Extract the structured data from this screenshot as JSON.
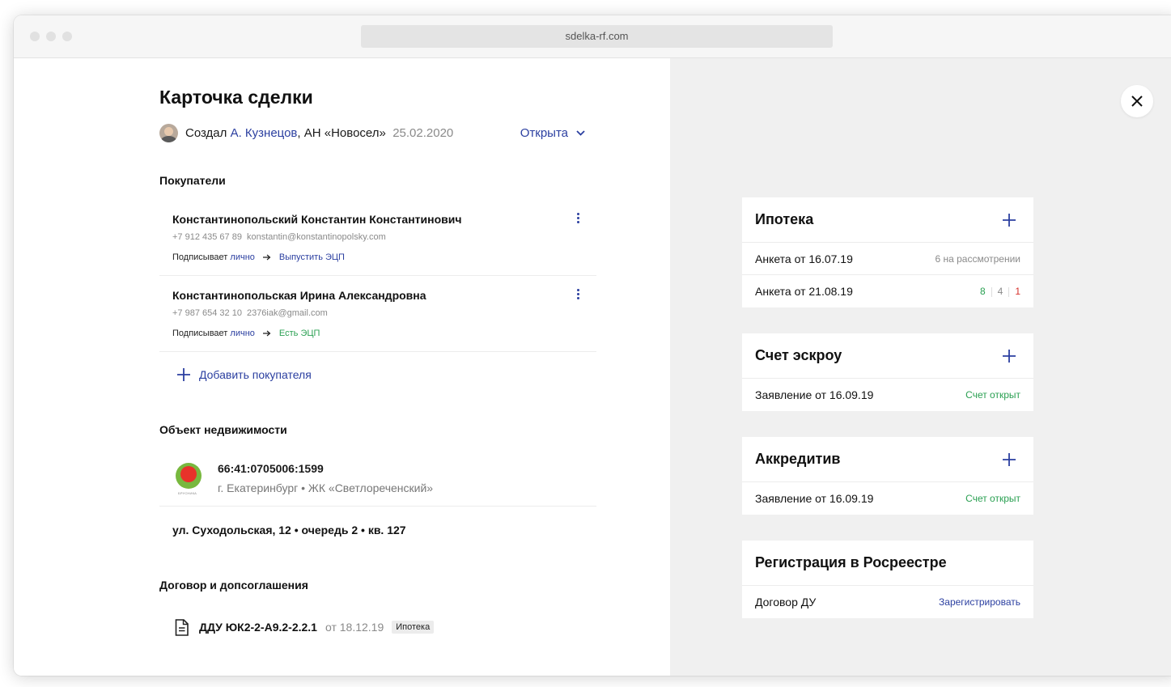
{
  "browser": {
    "url": "sdelka-rf.com"
  },
  "deal": {
    "title": "Карточка сделки",
    "created_prefix": "Создал",
    "creator_name": "А. Кузнецов",
    "creator_agency": ", АН «Новосел»",
    "created_date": "25.02.2020",
    "status": "Открыта"
  },
  "buyers": {
    "section_title": "Покупатели",
    "items": [
      {
        "name": "Константинопольский Константин Константинович",
        "phone": "+7 912 435 67 89",
        "email": "konstantin@konstantinopolsky.com",
        "sign_label": "Подписывает",
        "sign_mode": "лично",
        "ecp": "Выпустить ЭЦП",
        "ecp_color": "#2b3fa0"
      },
      {
        "name": "Константинопольская Ирина Александровна",
        "phone": "+7 987 654 32 10",
        "email": "2376iak@gmail.com",
        "sign_label": "Подписывает",
        "sign_mode": "лично",
        "ecp": "Есть ЭЦП",
        "ecp_color": "#2aa052"
      }
    ],
    "add_label": "Добавить покупателя"
  },
  "property": {
    "section_title": "Объект недвижимости",
    "logo_text": "БРУСНИКА",
    "cadastral": "66:41:0705006:1599",
    "location": "г. Екатеринбург • ЖК «Светлореченский»",
    "address": "ул. Суходольская, 12 • очередь 2 • кв. 127"
  },
  "contracts": {
    "section_title": "Договор и допсоглашения",
    "items": [
      {
        "name": "ДДУ ЮК2-2-А9.2-2.2.1",
        "date": "от 18.12.19",
        "tag": "Ипотека"
      }
    ]
  },
  "panels": {
    "mortgage": {
      "title": "Ипотека",
      "rows": [
        {
          "label": "Анкета от 16.07.19",
          "value": "6 на рассмотрении"
        },
        {
          "label": "Анкета от 21.08.19",
          "counts": [
            "8",
            "4",
            "1"
          ]
        }
      ]
    },
    "escrow": {
      "title": "Счет эскроу",
      "rows": [
        {
          "label": "Заявление от 16.09.19",
          "value": "Счет открыт"
        }
      ]
    },
    "letter_of_credit": {
      "title": "Аккредитив",
      "rows": [
        {
          "label": "Заявление от 16.09.19",
          "value": "Счет открыт"
        }
      ]
    },
    "registration": {
      "title": "Регистрация в Росреестре",
      "rows": [
        {
          "label": "Договор ДУ",
          "value": "Зарегистрировать"
        }
      ]
    }
  }
}
